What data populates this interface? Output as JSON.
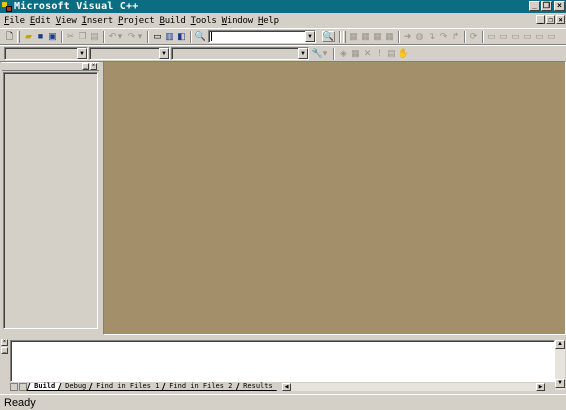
{
  "window": {
    "title": "Microsoft Visual C++",
    "minimize": "_",
    "restore": "❐",
    "close": "×"
  },
  "menubar": {
    "items": [
      {
        "first": "F",
        "rest": "ile"
      },
      {
        "first": "E",
        "rest": "dit"
      },
      {
        "first": "V",
        "rest": "iew"
      },
      {
        "first": "I",
        "rest": "nsert"
      },
      {
        "first": "P",
        "rest": "roject"
      },
      {
        "first": "B",
        "rest": "uild"
      },
      {
        "first": "T",
        "rest": "ools"
      },
      {
        "first": "W",
        "rest": "indow"
      },
      {
        "first": "H",
        "rest": "elp"
      }
    ]
  },
  "toolbar": {
    "find_combo_value": "",
    "class_combo_value": "",
    "member_combo_value": ""
  },
  "output": {
    "tabs": [
      "Build",
      "Debug",
      "Find in Files 1",
      "Find in Files 2",
      "Results"
    ],
    "active_tab": "Build",
    "content": ""
  },
  "status": {
    "text": "Ready"
  },
  "colors": {
    "titlebar": "#0a6d82",
    "mdi_background": "#a38f69",
    "face": "#d4d0c8"
  }
}
